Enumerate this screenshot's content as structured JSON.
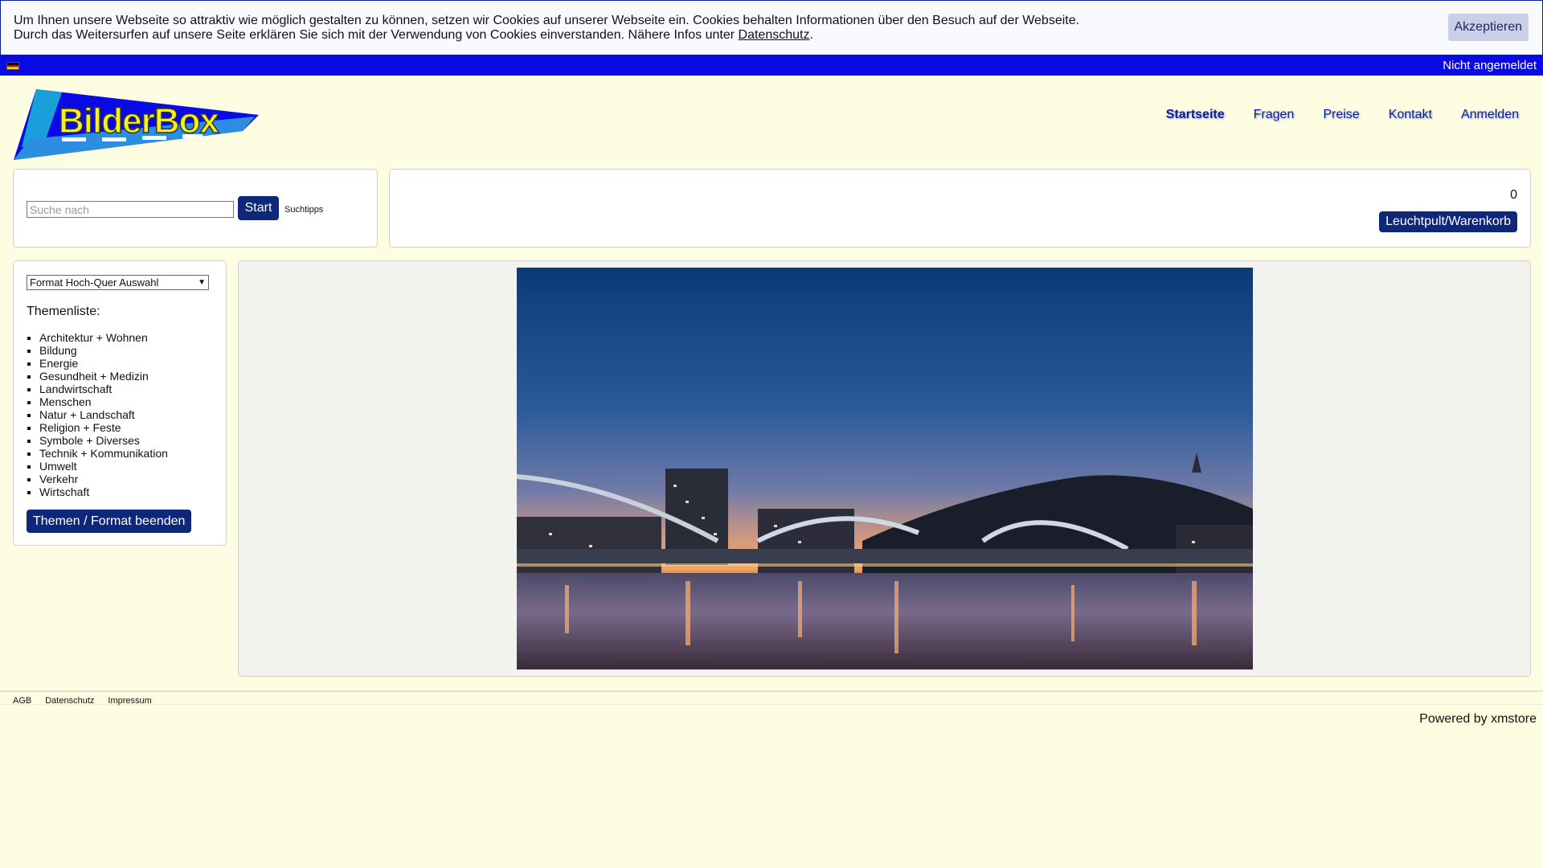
{
  "cookie": {
    "line1": "Um Ihnen unsere Webseite so attraktiv wie möglich gestalten zu können, setzen wir Cookies auf unserer Webseite ein. Cookies behalten Informationen über den Besuch auf der Webseite.",
    "line2_prefix": "Durch das Weitersurfen auf unsere Seite erklären Sie sich mit der Verwendung von Cookies einverstanden. Nähere Infos unter ",
    "link": "Datenschutz",
    "line2_suffix": ".",
    "accept_label": "Akzeptieren"
  },
  "topbar": {
    "language_icon": "flag-de-icon",
    "login_status": "Nicht angemeldet",
    "color": "#0a0ae6"
  },
  "logo": {
    "text": "BilderBox"
  },
  "nav": {
    "items": [
      "Startseite",
      "Fragen",
      "Preise",
      "Kontakt",
      "Anmelden"
    ],
    "active": "Startseite"
  },
  "search": {
    "placeholder": "Suche nach",
    "value": "",
    "button_label": "Start",
    "tips_label": "Suchtipps"
  },
  "cart": {
    "count": "0",
    "button_label": "Leuchtpult/Warenkorb"
  },
  "sidebar": {
    "format_select": "Format Hoch-Quer Auswahl",
    "themen_title": "Themenliste:",
    "themen": [
      "Architektur + Wohnen",
      "Bildung",
      "Energie",
      "Gesundheit + Medizin",
      "Landwirtschaft",
      "Menschen",
      "Natur + Landschaft",
      "Religion + Feste",
      "Symbole + Diverses",
      "Technik + Kommunikation",
      "Umwelt",
      "Verkehr",
      "Wirtschaft"
    ],
    "end_button_label": "Themen / Format beenden"
  },
  "footer": {
    "links": [
      "AGB",
      "Datenschutz",
      "Impressum"
    ],
    "powered": "Powered by xmstore"
  },
  "colors": {
    "background": "#fdfde1",
    "button": "#0e2778",
    "nav_link": "#0b1e9c"
  }
}
